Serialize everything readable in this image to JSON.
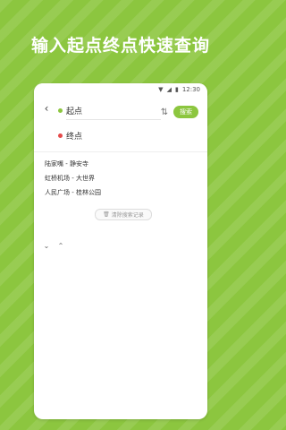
{
  "headline": "输入起点终点快速查询",
  "statusbar": {
    "time": "12:30"
  },
  "route": {
    "start_label": "起点",
    "end_label": "终点",
    "search_label": "搜索"
  },
  "history": {
    "items": [
      "陆家嘴 - 静安寺",
      "虹桥机场 - 大世界",
      "人民广场 - 桂林公园"
    ],
    "clear_label": "清除搜索记录"
  },
  "colors": {
    "accent": "#8cc63f",
    "end_dot": "#e54a4a"
  }
}
